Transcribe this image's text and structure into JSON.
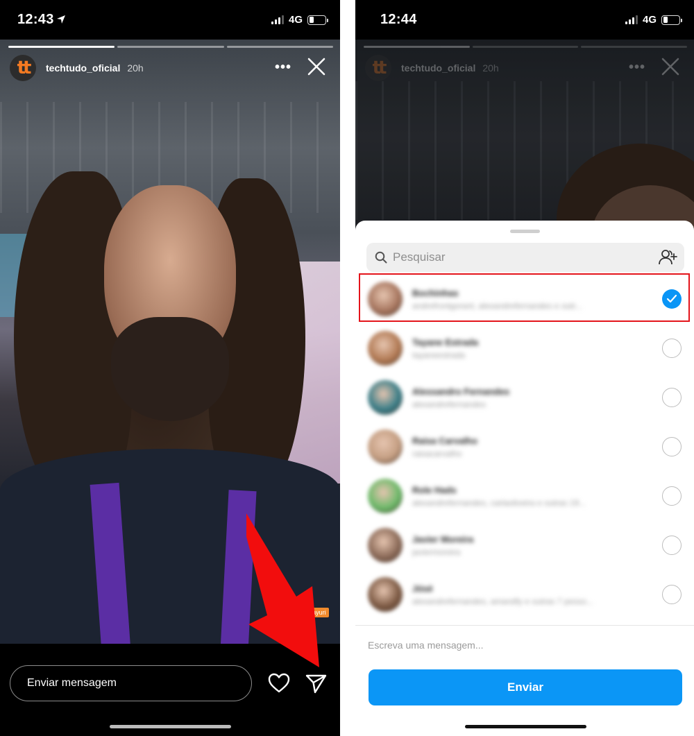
{
  "left": {
    "status": {
      "time": "12:43",
      "network": "4G"
    },
    "story": {
      "username": "techtudo_oficial",
      "age": "20h",
      "avatar_text": "tt",
      "mention_tag": "@hildebrayuri",
      "progress_total": 3,
      "progress_done": 1
    },
    "reply_placeholder": "Enviar mensagem",
    "arrow_color": "#f20d0d"
  },
  "right": {
    "status": {
      "time": "12:44",
      "network": "4G"
    },
    "story": {
      "username": "techtudo_oficial",
      "age": "20h",
      "avatar_text": "tt"
    },
    "search_placeholder": "Pesquisar",
    "contacts": [
      {
        "name": "Bochinhas",
        "subtitle": "andrefrontgorant, alexandrefernandes e outr...",
        "checked": true,
        "avatar_color": "#a7765f"
      },
      {
        "name": "Tayane Estrada",
        "subtitle": "tayaneestrada",
        "checked": false,
        "avatar_color": "#b27a54"
      },
      {
        "name": "Alessandro Fernandes",
        "subtitle": "alexandrefernandes",
        "checked": false,
        "avatar_color": "#3b7e88"
      },
      {
        "name": "Raisa Carvalho",
        "subtitle": "raisacarvalho",
        "checked": false,
        "avatar_color": "#c49e82"
      },
      {
        "name": "Role Hads",
        "subtitle": "alexandrefernandes, carlaoliveira e outras 19...",
        "checked": false,
        "avatar_color": "#6dba6a"
      },
      {
        "name": "Javier Moreira",
        "subtitle": "javiermoreira",
        "checked": false,
        "avatar_color": "#8b6a58"
      },
      {
        "name": "Jósé",
        "subtitle": "alexandrefernandes, amandfy e outras 7 pesso...",
        "checked": false,
        "avatar_color": "#7d5a44"
      }
    ],
    "message_placeholder": "Escreva uma mensagem...",
    "send_label": "Enviar",
    "accent_color": "#0095f6",
    "highlight_color": "#e4141b"
  }
}
